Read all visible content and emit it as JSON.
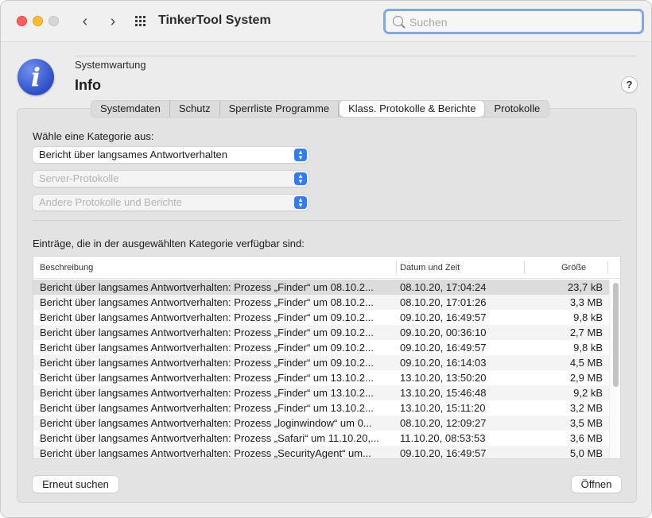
{
  "app": {
    "title": "TinkerTool System"
  },
  "search": {
    "placeholder": "Suchen",
    "value": ""
  },
  "header": {
    "section": "Systemwartung",
    "title": "Info",
    "help_label": "?"
  },
  "tabs": [
    {
      "label": "Systemdaten",
      "active": false
    },
    {
      "label": "Schutz",
      "active": false
    },
    {
      "label": "Sperrliste Programme",
      "active": false
    },
    {
      "label": "Klass. Protokolle & Berichte",
      "active": true
    },
    {
      "label": "Protokolle",
      "active": false
    }
  ],
  "category": {
    "label": "Wähle eine Kategorie aus:",
    "popups": [
      {
        "value": "Bericht über langsames Antwortverhalten",
        "enabled": true
      },
      {
        "value": "Server-Protokolle",
        "enabled": false
      },
      {
        "value": "Andere Protokolle und Berichte",
        "enabled": false
      }
    ]
  },
  "entries": {
    "label": "Einträge, die in der ausgewählten Kategorie verfügbar sind:",
    "columns": [
      "Beschreibung",
      "Datum und Zeit",
      "Größe"
    ],
    "rows": [
      {
        "desc": "Bericht über langsames Antwortverhalten: Prozess „Finder“ um 08.10.2...",
        "date": "08.10.20, 17:04:24",
        "size": "23,7 kB",
        "selected": true
      },
      {
        "desc": "Bericht über langsames Antwortverhalten: Prozess „Finder“ um 08.10.2...",
        "date": "08.10.20, 17:01:26",
        "size": "3,3 MB"
      },
      {
        "desc": "Bericht über langsames Antwortverhalten: Prozess „Finder“ um 09.10.2...",
        "date": "09.10.20, 16:49:57",
        "size": "9,8 kB"
      },
      {
        "desc": "Bericht über langsames Antwortverhalten: Prozess „Finder“ um 09.10.2...",
        "date": "09.10.20, 00:36:10",
        "size": "2,7 MB"
      },
      {
        "desc": "Bericht über langsames Antwortverhalten: Prozess „Finder“ um 09.10.2...",
        "date": "09.10.20, 16:49:57",
        "size": "9,8 kB"
      },
      {
        "desc": "Bericht über langsames Antwortverhalten: Prozess „Finder“ um 09.10.2...",
        "date": "09.10.20, 16:14:03",
        "size": "4,5 MB"
      },
      {
        "desc": "Bericht über langsames Antwortverhalten: Prozess „Finder“ um 13.10.2...",
        "date": "13.10.20, 13:50:20",
        "size": "2,9 MB"
      },
      {
        "desc": "Bericht über langsames Antwortverhalten: Prozess „Finder“ um 13.10.2...",
        "date": "13.10.20, 15:46:48",
        "size": "9,2 kB"
      },
      {
        "desc": "Bericht über langsames Antwortverhalten: Prozess „Finder“ um 13.10.2...",
        "date": "13.10.20, 15:11:20",
        "size": "3,2 MB"
      },
      {
        "desc": "Bericht über langsames Antwortverhalten: Prozess „loginwindow“ um 0...",
        "date": "08.10.20, 12:09:27",
        "size": "3,5 MB"
      },
      {
        "desc": "Bericht über langsames Antwortverhalten: Prozess „Safari“ um 11.10.20,...",
        "date": "11.10.20, 08:53:53",
        "size": "3,6 MB"
      },
      {
        "desc": "Bericht über langsames Antwortverhalten: Prozess „SecurityAgent“ um...",
        "date": "09.10.20, 16:49:57",
        "size": "5,0 MB"
      }
    ]
  },
  "buttons": {
    "rescan": "Erneut suchen",
    "open": "Öffnen"
  },
  "colors": {
    "accent": "#2f7df6",
    "selection": "#dcdcdc"
  }
}
